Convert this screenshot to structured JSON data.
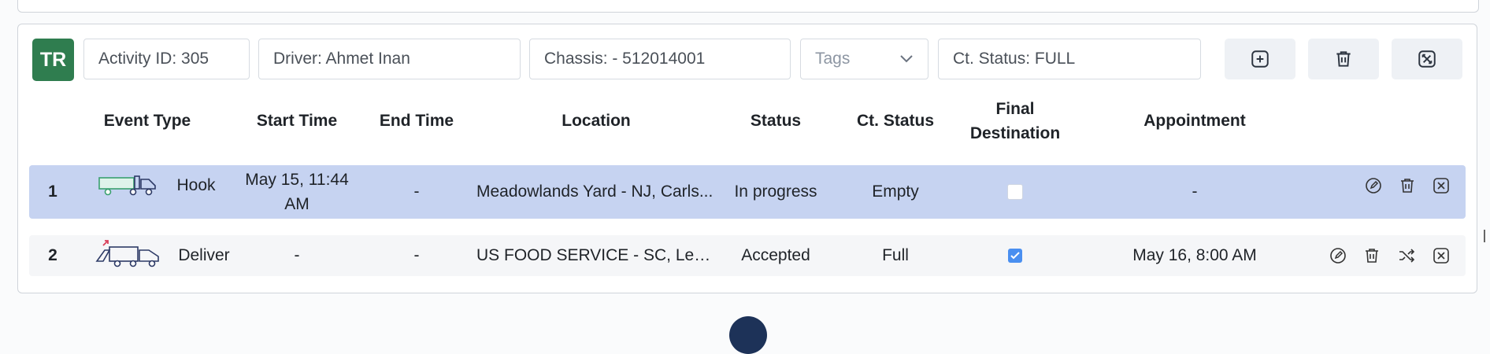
{
  "header": {
    "badge": "TR",
    "activity_id": "Activity ID: 305",
    "driver": "Driver: Ahmet Inan",
    "chassis": "Chassis:  - 512014001",
    "tags_placeholder": "Tags",
    "ct_status": "Ct. Status: FULL"
  },
  "buttons": [
    "add-icon",
    "trash-icon",
    "close-box-icon"
  ],
  "columns": {
    "event_type": "Event Type",
    "start_time": "Start Time",
    "end_time": "End Time",
    "location": "Location",
    "status": "Status",
    "ct_status": "Ct. Status",
    "final_destination": "Final Destination",
    "appointment": "Appointment"
  },
  "rows": [
    {
      "num": "1",
      "event_type": "Hook",
      "start_time": "May 15, 11:44 AM",
      "end_time": "-",
      "location": "Meadowlands Yard - NJ, Carls...",
      "status": "In progress",
      "ct_status": "Empty",
      "final_destination": false,
      "appointment": "-",
      "actions": [
        "edit-icon",
        "trash-icon",
        "close-box-icon"
      ]
    },
    {
      "num": "2",
      "event_type": "Deliver",
      "start_time": "-",
      "end_time": "-",
      "location": "US FOOD SERVICE - SC, Lexi...",
      "status": "Accepted",
      "ct_status": "Full",
      "final_destination": true,
      "appointment": "May 16, 8:00 AM",
      "actions": [
        "edit-icon",
        "trash-icon",
        "shuffle-icon",
        "close-box-icon"
      ]
    }
  ],
  "colors": {
    "badge": "#2f7d4f",
    "selected_row": "#c6d3f1",
    "checkbox": "#4a8ff0",
    "note_orange": "#f0a36b"
  }
}
